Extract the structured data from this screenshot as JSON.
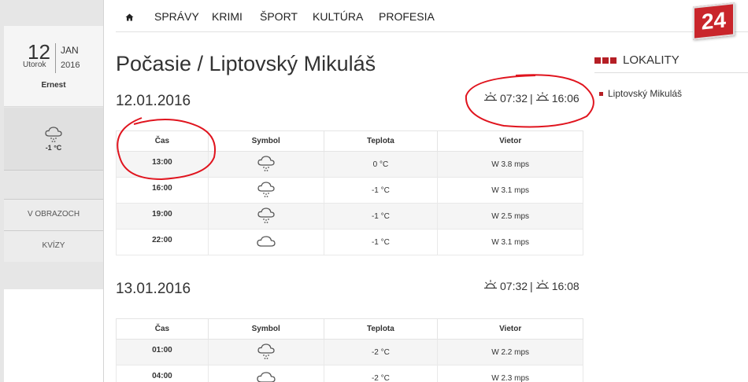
{
  "sidebar": {
    "day": "12",
    "weekday": "Utorok",
    "month": "JAN",
    "year": "2016",
    "nameday": "Ernest",
    "weather_temp": "-1 °C",
    "weather_icon": "snow-cloud-icon",
    "links": [
      {
        "label": "V OBRAZOCH"
      },
      {
        "label": "KVÍZY"
      }
    ]
  },
  "nav": {
    "home_icon": "home-icon",
    "items": [
      "SPRÁVY",
      "KRIMI",
      "ŠPORT",
      "KULTÚRA",
      "PROFESIA"
    ],
    "logo": "24"
  },
  "page": {
    "title": "Počasie / Liptovský Mikuláš"
  },
  "days": [
    {
      "date": "12.01.2016",
      "sunrise": "07:32",
      "sunset": "16:06",
      "headers": [
        "Čas",
        "Symbol",
        "Teplota",
        "Vietor"
      ],
      "rows": [
        {
          "time": "13:00",
          "symbol": "snow-cloud-icon",
          "temp": "0 °C",
          "wind": "W 3.8 mps"
        },
        {
          "time": "16:00",
          "symbol": "snow-cloud-icon",
          "temp": "-1 °C",
          "wind": "W 3.1 mps"
        },
        {
          "time": "19:00",
          "symbol": "snow-cloud-icon",
          "temp": "-1 °C",
          "wind": "W 2.5 mps"
        },
        {
          "time": "22:00",
          "symbol": "cloud-icon",
          "temp": "-1 °C",
          "wind": "W 3.1 mps"
        }
      ]
    },
    {
      "date": "13.01.2016",
      "sunrise": "07:32",
      "sunset": "16:08",
      "headers": [
        "Čas",
        "Symbol",
        "Teplota",
        "Vietor"
      ],
      "rows": [
        {
          "time": "01:00",
          "symbol": "snow-cloud-icon",
          "temp": "-2 °C",
          "wind": "W 2.2 mps"
        },
        {
          "time": "04:00",
          "symbol": "cloud-icon",
          "temp": "-2 °C",
          "wind": "W 2.3 mps"
        }
      ]
    }
  ],
  "localities": {
    "heading": "LOKALITY",
    "items": [
      "Liptovský Mikuláš"
    ]
  },
  "colors": {
    "accent": "#b51f25",
    "annotation": "#e0141e",
    "rail": "#e6e6e6"
  }
}
